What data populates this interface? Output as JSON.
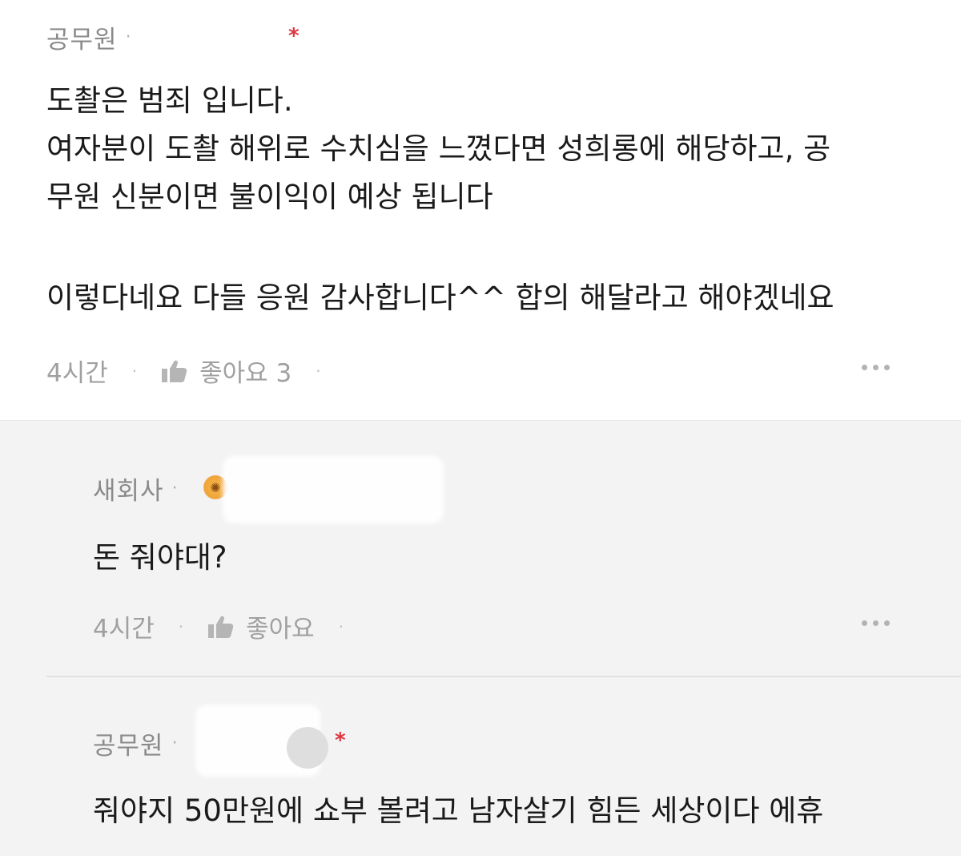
{
  "comment": {
    "author": "공무원",
    "separator": "·",
    "star": "*",
    "lines": [
      "도촬은 범죄 입니다.",
      "여자분이 도촬 해위로 수치심을 느꼈다면 성희롱에 해당하고, 공",
      "무원 신분이면 불이익이 예상 됩니다",
      "이렇다네요 다들 응원 감사합니다^^ 합의 해달라고 해야겠네요"
    ],
    "time": "4시간",
    "like_label": "좋아요 3",
    "footer_sep": "·"
  },
  "replies": [
    {
      "author": "새회사",
      "separator": "·",
      "badge_icon": "flower-badge-icon",
      "text": "돈 줘야대?",
      "time": "4시간",
      "like_label": "좋아요",
      "footer_sep": "·"
    },
    {
      "author": "공무원",
      "separator": "·",
      "star": "*",
      "text": "줘야지 50만원에 쇼부 볼려고 남자살기 힘든 세상이다 에휴"
    }
  ],
  "colors": {
    "accent_star": "#e0353f",
    "meta_text": "#8a8a8a",
    "reply_background": "#f3f3f3"
  }
}
